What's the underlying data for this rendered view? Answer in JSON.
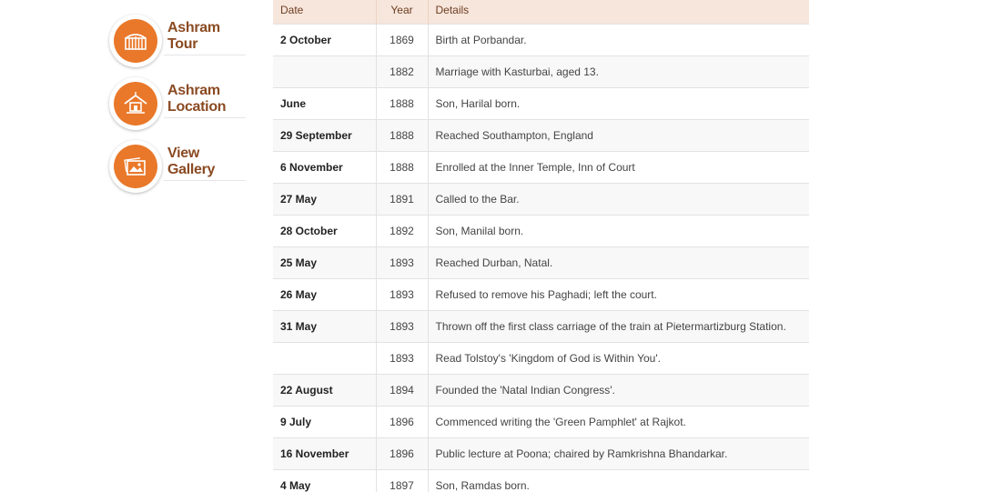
{
  "sidebar": {
    "items": [
      {
        "line1": "Ashram",
        "line2": "Tour",
        "icon": "gate-icon"
      },
      {
        "line1": "Ashram",
        "line2": "Location",
        "icon": "hut-location-icon"
      },
      {
        "line1": "View",
        "line2": "Gallery",
        "icon": "photo-gallery-icon"
      }
    ],
    "accent_color": "#e9782a",
    "label_color": "#8a4a22"
  },
  "table": {
    "headers": {
      "date": "Date",
      "year": "Year",
      "details": "Details"
    },
    "header_bg": "#f7e6dc",
    "rows": [
      {
        "date": "2 October",
        "year": "1869",
        "details": "Birth at Porbandar."
      },
      {
        "date": "",
        "year": "1882",
        "details": "Marriage with Kasturbai, aged 13."
      },
      {
        "date": "June",
        "year": "1888",
        "details": "Son, Harilal born."
      },
      {
        "date": "29 September",
        "year": "1888",
        "details": "Reached Southampton, England"
      },
      {
        "date": "6 November",
        "year": "1888",
        "details": "Enrolled at the Inner Temple, Inn of Court"
      },
      {
        "date": "27 May",
        "year": "1891",
        "details": "Called to the Bar."
      },
      {
        "date": "28 October",
        "year": "1892",
        "details": "Son, Manilal born."
      },
      {
        "date": "25 May",
        "year": "1893",
        "details": "Reached Durban, Natal."
      },
      {
        "date": "26 May",
        "year": "1893",
        "details": "Refused to remove his Paghadi; left the court."
      },
      {
        "date": "31 May",
        "year": "1893",
        "details": "Thrown off the first class carriage of the train at Pietermartizburg Station."
      },
      {
        "date": "",
        "year": "1893",
        "details": "Read Tolstoy's 'Kingdom of God is Within You'."
      },
      {
        "date": "22 August",
        "year": "1894",
        "details": "Founded the 'Natal Indian Congress'."
      },
      {
        "date": "9 July",
        "year": "1896",
        "details": "Commenced writing the 'Green Pamphlet' at Rajkot."
      },
      {
        "date": "16 November",
        "year": "1896",
        "details": "Public lecture at Poona; chaired by Ramkrishna Bhandarkar."
      },
      {
        "date": "4 May",
        "year": "1897",
        "details": "Son, Ramdas born."
      }
    ]
  }
}
